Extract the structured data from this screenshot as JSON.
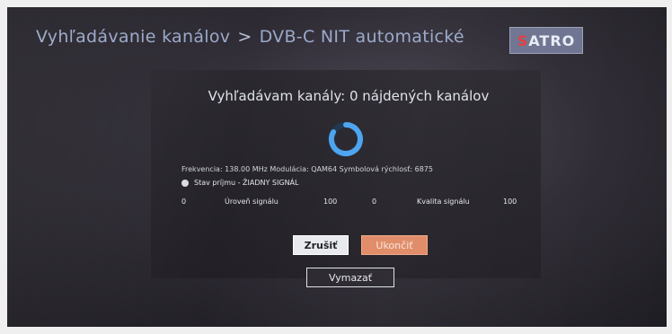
{
  "header": {
    "title": "Vyhľadávanie kanálov",
    "separator": ">",
    "subtitle": "DVB-C NIT automatické",
    "logo_text": "SATRO"
  },
  "scan": {
    "heading": "Vyhľadávam kanály: 0 nájdených kanálov",
    "info_line": "Frekvencia: 138.00 MHz Modulácia: QAM64 Symbolová rýchlosť: 6875",
    "status": "Stav príjmu - ŽIADNY SIGNÁL",
    "level_left_value": "0",
    "level_label": "Úroveň signálu",
    "level_right_value": "100",
    "quality_left_value": "0",
    "quality_label": "Kvalita signálu",
    "quality_right_value": "100"
  },
  "buttons": {
    "cancel": "Zrušiť",
    "finish": "Ukončiť",
    "delete": "Vymazať"
  },
  "colors": {
    "accent_spinner": "#4aa3f0",
    "finish_button": "#e08a66",
    "logo_background": "#6e7490"
  }
}
